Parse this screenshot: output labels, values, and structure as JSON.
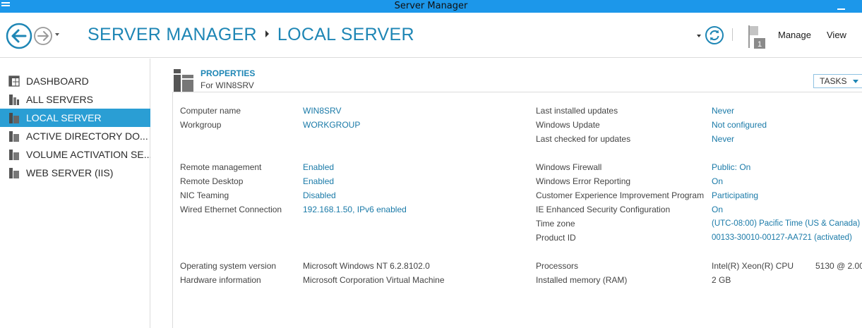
{
  "window": {
    "title": "Server Manager"
  },
  "header": {
    "breadcrumb": [
      "SERVER MANAGER",
      "LOCAL SERVER"
    ],
    "notification_count": "1",
    "menus": {
      "manage": "Manage",
      "view": "View"
    }
  },
  "sidebar": {
    "items": [
      {
        "label": "DASHBOARD",
        "icon": "dashboard-icon",
        "selected": false
      },
      {
        "label": "ALL SERVERS",
        "icon": "servers-icon",
        "selected": false
      },
      {
        "label": "LOCAL SERVER",
        "icon": "server-icon",
        "selected": true
      },
      {
        "label": "ACTIVE DIRECTORY DO...",
        "icon": "servers-icon",
        "selected": false
      },
      {
        "label": "VOLUME ACTIVATION SE...",
        "icon": "servers-icon",
        "selected": false
      },
      {
        "label": "WEB SERVER (IIS)",
        "icon": "servers-icon",
        "selected": false
      }
    ]
  },
  "properties": {
    "title": "PROPERTIES",
    "subtitle": "For WIN8SRV",
    "tasks_label": "TASKS",
    "left": {
      "computer_name": {
        "label": "Computer name",
        "value": "WIN8SRV"
      },
      "workgroup": {
        "label": "Workgroup",
        "value": "WORKGROUP"
      },
      "remote_management": {
        "label": "Remote management",
        "value": "Enabled"
      },
      "remote_desktop": {
        "label": "Remote Desktop",
        "value": "Enabled"
      },
      "nic_teaming": {
        "label": "NIC Teaming",
        "value": "Disabled"
      },
      "wired_ethernet": {
        "label": "Wired Ethernet Connection",
        "value": "192.168.1.50, IPv6 enabled"
      },
      "os_version": {
        "label": "Operating system version",
        "value": "Microsoft Windows NT 6.2.8102.0"
      },
      "hardware": {
        "label": "Hardware information",
        "value": "Microsoft Corporation Virtual Machine"
      }
    },
    "right": {
      "last_installed_updates": {
        "label": "Last installed updates",
        "value": "Never"
      },
      "windows_update": {
        "label": "Windows Update",
        "value": "Not configured"
      },
      "last_checked": {
        "label": "Last checked for updates",
        "value": "Never"
      },
      "windows_firewall": {
        "label": "Windows Firewall",
        "value": "Public: On"
      },
      "error_reporting": {
        "label": "Windows Error Reporting",
        "value": "On"
      },
      "ceip": {
        "label": "Customer Experience Improvement Program",
        "value": "Participating"
      },
      "ie_esc": {
        "label": "IE Enhanced Security Configuration",
        "value": "On"
      },
      "time_zone": {
        "label": "Time zone",
        "value": "(UTC-08:00) Pacific Time (US & Canada)"
      },
      "product_id": {
        "label": "Product ID",
        "value": "00133-30010-00127-AA721 (activated)"
      },
      "processors": {
        "label": "Processors",
        "value": "Intel(R) Xeon(R) CPU",
        "value2": "5130  @ 2.00"
      },
      "memory": {
        "label": "Installed memory (RAM)",
        "value": "2 GB"
      }
    }
  },
  "colors": {
    "titlebar": "#1c97ea",
    "accent": "#1e86b5",
    "selected_nav": "#2a9ed4"
  }
}
